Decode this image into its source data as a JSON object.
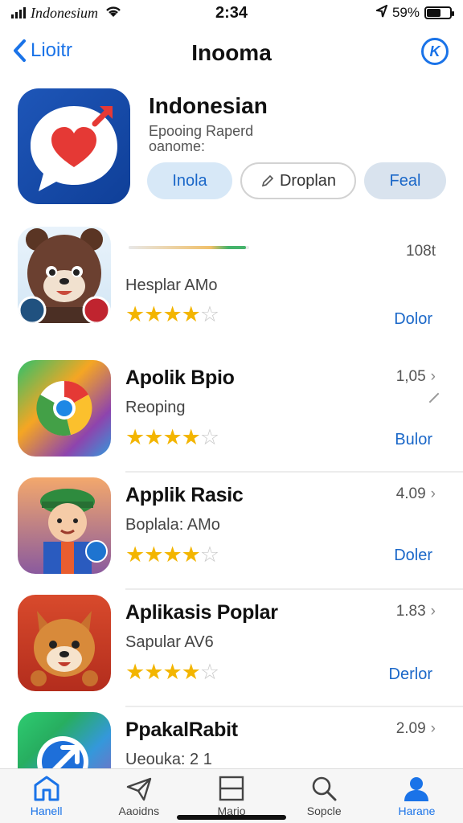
{
  "status": {
    "carrier": "Indonesium",
    "time": "2:34",
    "battery": "59%",
    "battery_level": 0.59
  },
  "nav": {
    "back_label": "Lioitr",
    "title": "Inooma"
  },
  "featured": {
    "title": "Indonesian",
    "subtitle_line1": "Epooing Raperd",
    "subtitle_line2": "oanome:",
    "buttons": [
      "Inola",
      "Droplan",
      "Feal"
    ]
  },
  "apps": [
    {
      "name": "",
      "subtitle": "Hesplar AMo",
      "count": "108t",
      "action": "Dolor",
      "rating": 4,
      "download_progress": 0.97
    },
    {
      "name": "Apolik Bpio",
      "subtitle": "Reoping",
      "count": "1,05",
      "action": "Bulor",
      "rating": 4
    },
    {
      "name": "Applik Rasic",
      "subtitle": "Boplala: AMo",
      "count": "4.09",
      "action": "Doler",
      "rating": 4
    },
    {
      "name": "Aplikasis Poplar",
      "subtitle": "Sapular AV6",
      "count": "1.83",
      "action": "Derlor",
      "rating": 4
    },
    {
      "name": "PpakalRabit",
      "subtitle": "Ueouka: 2 1",
      "count": "2.09",
      "action": "",
      "rating": 0
    }
  ],
  "tabs": [
    {
      "label": "Hanell",
      "icon": "home-icon"
    },
    {
      "label": "Aaoidns",
      "icon": "paper-plane-icon"
    },
    {
      "label": "Mario",
      "icon": "square-grid-icon"
    },
    {
      "label": "Sopcle",
      "icon": "search-icon"
    },
    {
      "label": "Harane",
      "icon": "person-icon"
    }
  ],
  "colors": {
    "accent": "#1a73e8",
    "star": "#f3b500"
  }
}
